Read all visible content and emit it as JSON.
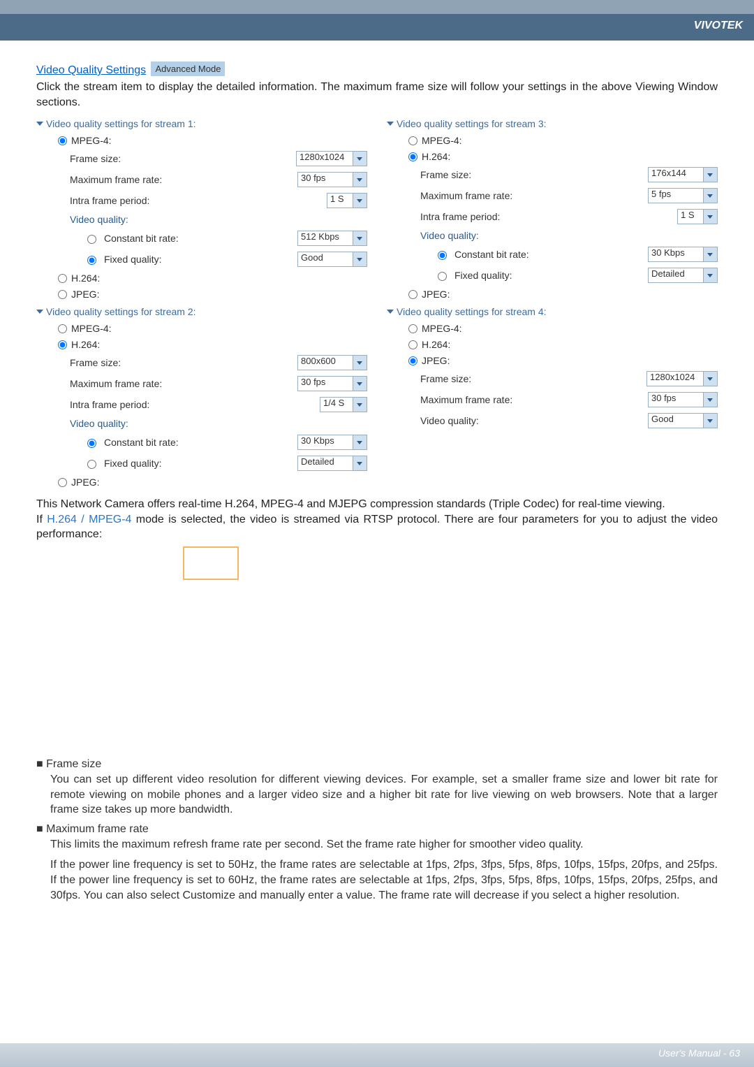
{
  "brand": "VIVOTEK",
  "heading": {
    "link": "Video Quality Settings",
    "badge": "Advanced Mode"
  },
  "intro": "Click the stream item to display the detailed information. The maximum frame size will follow your settings in the above Viewing Window sections.",
  "panels": {
    "s1": {
      "title": "Video quality settings for stream 1:",
      "mpeg4": "MPEG-4:",
      "h264": "H.264:",
      "jpeg": "JPEG:",
      "fields": {
        "framesize": "Frame size:",
        "maxfr": "Maximum frame rate:",
        "intra": "Intra frame period:",
        "vq": "Video quality:",
        "cbr": "Constant bit rate:",
        "fq": "Fixed quality:"
      },
      "vals": {
        "framesize": "1280x1024",
        "maxfr": "30 fps",
        "intra": "1 S",
        "cbr": "512 Kbps",
        "fq": "Good"
      }
    },
    "s2": {
      "title": "Video quality settings for stream 2:",
      "mpeg4": "MPEG-4:",
      "h264": "H.264:",
      "jpeg": "JPEG:",
      "fields": {
        "framesize": "Frame size:",
        "maxfr": "Maximum frame rate:",
        "intra": "Intra frame period:",
        "vq": "Video quality:",
        "cbr": "Constant bit rate:",
        "fq": "Fixed quality:"
      },
      "vals": {
        "framesize": "800x600",
        "maxfr": "30 fps",
        "intra": "1/4 S",
        "cbr": "30 Kbps",
        "fq": "Detailed"
      }
    },
    "s3": {
      "title": "Video quality settings for stream 3:",
      "mpeg4": "MPEG-4:",
      "h264": "H.264:",
      "jpeg": "JPEG:",
      "fields": {
        "framesize": "Frame size:",
        "maxfr": "Maximum frame rate:",
        "intra": "Intra frame period:",
        "vq": "Video quality:",
        "cbr": "Constant bit rate:",
        "fq": "Fixed quality:"
      },
      "vals": {
        "framesize": "176x144",
        "maxfr": "5 fps",
        "intra": "1 S",
        "cbr": "30 Kbps",
        "fq": "Detailed"
      }
    },
    "s4": {
      "title": "Video quality settings for stream 4:",
      "mpeg4": "MPEG-4:",
      "h264": "H.264:",
      "jpeg": "JPEG:",
      "fields": {
        "framesize": "Frame size:",
        "maxfr": "Maximum frame rate:",
        "vq": "Video quality:"
      },
      "vals": {
        "framesize": "1280x1024",
        "maxfr": "30 fps",
        "vq": "Good"
      }
    }
  },
  "triple": {
    "l1": "This Network Camera offers real-time H.264, MPEG-4 and MJEPG compression standards (Triple Codec) for real-time viewing.",
    "l2a": "If ",
    "l2b": "H.264 / MPEG-4",
    "l2c": " mode is selected, the video is streamed via RTSP protocol. There are four parameters for you to adjust the video performance:"
  },
  "bullets": {
    "b1": {
      "h": "■ Frame size",
      "t": "You can set up different video resolution for different viewing devices. For example, set a smaller frame size and lower bit rate for remote viewing on mobile phones and a larger video size and a higher bit rate for live viewing on web browsers. Note that a larger frame size takes up more bandwidth."
    },
    "b2": {
      "h": "■ Maximum frame rate",
      "t1": "This limits the maximum refresh frame rate per second. Set the frame rate higher for smoother video quality.",
      "t2": "If the power line frequency is set to 50Hz, the frame rates are selectable at 1fps, 2fps, 3fps, 5fps, 8fps, 10fps, 15fps, 20fps, and 25fps. If the power line frequency is set to 60Hz, the frame rates are selectable at 1fps, 2fps, 3fps, 5fps, 8fps, 10fps, 15fps, 20fps, 25fps, and 30fps. You can also select Customize and manually enter a value. The frame rate will decrease if you select a higher resolution."
    }
  },
  "footer": "User's Manual - 63"
}
